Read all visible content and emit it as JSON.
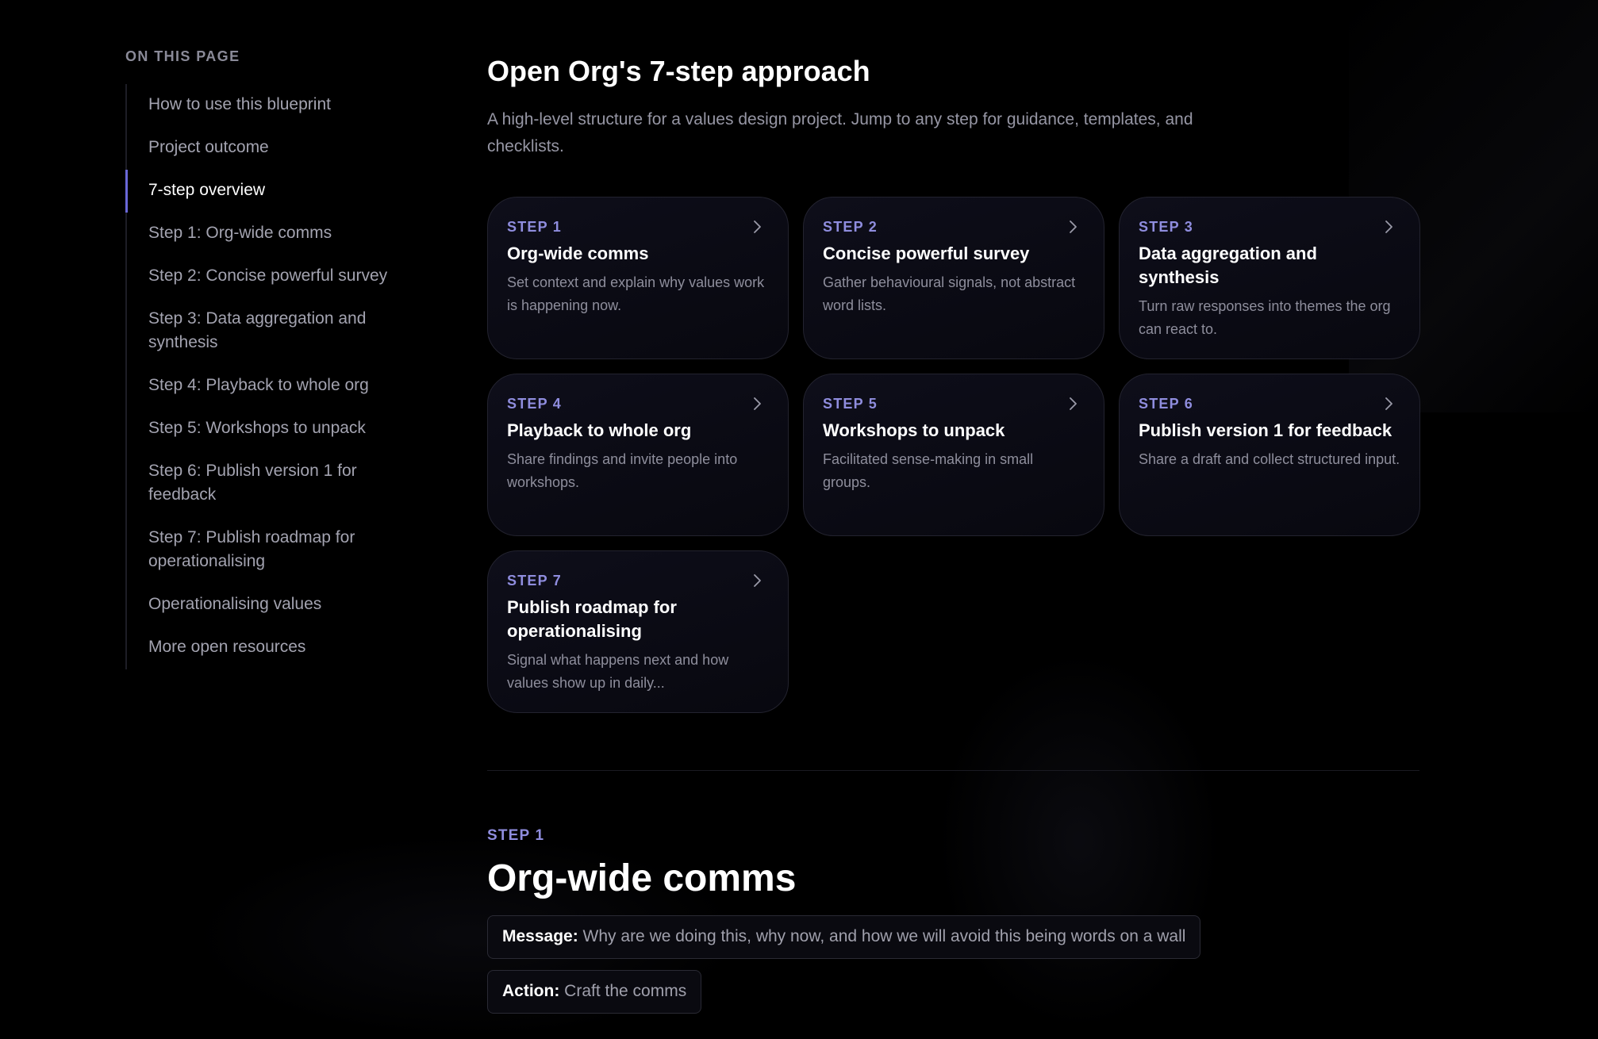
{
  "toc": {
    "heading": "ON THIS PAGE",
    "items": [
      {
        "label": "How to use this blueprint",
        "active": false
      },
      {
        "label": "Project outcome",
        "active": false
      },
      {
        "label": "7-step overview",
        "active": true
      },
      {
        "label": "Step 1: Org-wide comms",
        "active": false
      },
      {
        "label": "Step 2: Concise powerful survey",
        "active": false
      },
      {
        "label": "Step 3: Data aggregation and synthesis",
        "active": false
      },
      {
        "label": "Step 4: Playback to whole org",
        "active": false
      },
      {
        "label": "Step 5: Workshops to unpack",
        "active": false
      },
      {
        "label": "Step 6: Publish version 1 for feedback",
        "active": false
      },
      {
        "label": "Step 7: Publish roadmap for operationalising",
        "active": false
      },
      {
        "label": "Operationalising values",
        "active": false
      },
      {
        "label": "More open resources",
        "active": false
      }
    ]
  },
  "overview": {
    "title": "Open Org's 7-step approach",
    "intro": "A high-level structure for a values design project. Jump to any step for guidance, templates, and checklists.",
    "cards": [
      {
        "step": "STEP 1",
        "title": "Org-wide comms",
        "desc": "Set context and explain why values work is happening now."
      },
      {
        "step": "STEP 2",
        "title": "Concise powerful survey",
        "desc": "Gather behavioural signals, not abstract word lists."
      },
      {
        "step": "STEP 3",
        "title": "Data aggregation and synthesis",
        "desc": "Turn raw responses into themes the org can react to."
      },
      {
        "step": "STEP 4",
        "title": "Playback to whole org",
        "desc": "Share findings and invite people into workshops."
      },
      {
        "step": "STEP 5",
        "title": "Workshops to unpack",
        "desc": "Facilitated sense-making in small groups."
      },
      {
        "step": "STEP 6",
        "title": "Publish version 1 for feedback",
        "desc": "Share a draft and collect structured input."
      },
      {
        "step": "STEP 7",
        "title": "Publish roadmap for operationalising",
        "desc": "Signal what happens next and how values show up in daily..."
      }
    ]
  },
  "step_section": {
    "step": "STEP 1",
    "title": "Org-wide comms",
    "message_key": "Message:",
    "message_value": " Why are we doing this, why now, and how we will avoid this being words on a wall",
    "action_key": "Action:",
    "action_value": " Craft the comms"
  },
  "colors": {
    "accent": "#8f8dde",
    "active_indicator": "#6a68d8",
    "background": "#000000"
  },
  "icons": {
    "card_arrow": "chevron-right-icon"
  }
}
